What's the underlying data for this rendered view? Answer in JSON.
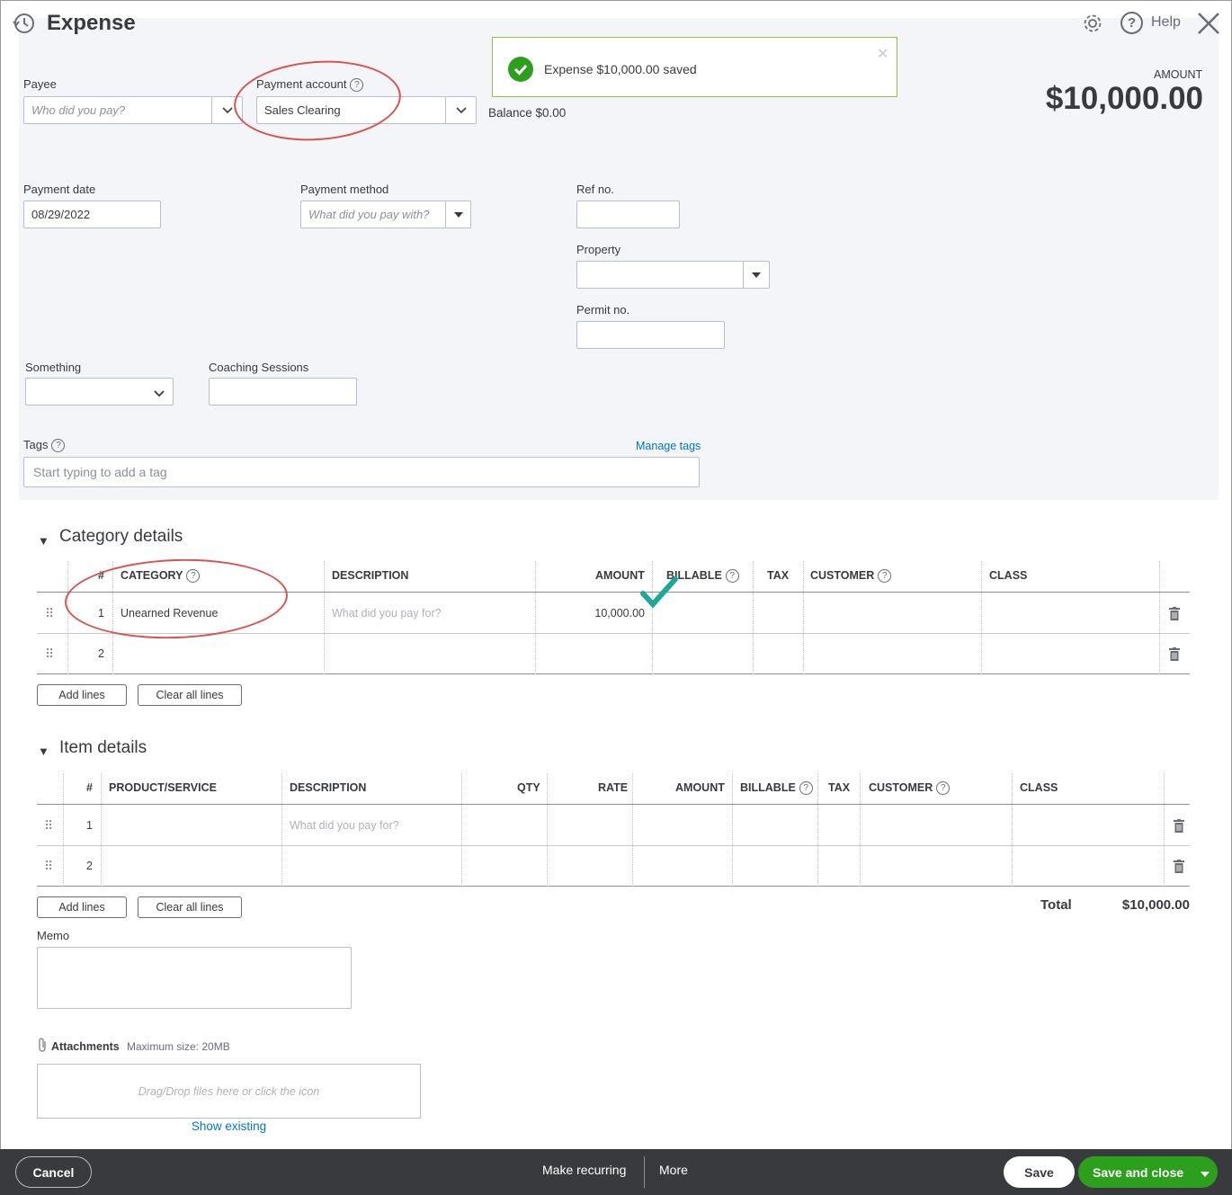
{
  "header": {
    "title": "Expense",
    "help_label": "Help"
  },
  "toast": {
    "message": "Expense $10,000.00 saved"
  },
  "amount": {
    "label": "AMOUNT",
    "value": "$10,000.00"
  },
  "payee": {
    "label": "Payee",
    "placeholder": "Who did you pay?"
  },
  "payment_account": {
    "label": "Payment account",
    "value": "Sales Clearing",
    "balance": "Balance $0.00"
  },
  "payment_date": {
    "label": "Payment date",
    "value": "08/29/2022"
  },
  "payment_method": {
    "label": "Payment method",
    "placeholder": "What did you pay with?"
  },
  "ref_no": {
    "label": "Ref no."
  },
  "property": {
    "label": "Property"
  },
  "permit_no": {
    "label": "Permit no."
  },
  "something": {
    "label": "Something"
  },
  "coaching": {
    "label": "Coaching Sessions"
  },
  "tags": {
    "label": "Tags",
    "manage": "Manage tags",
    "placeholder": "Start typing to add a tag"
  },
  "category_details": {
    "title": "Category details",
    "headers": {
      "num": "#",
      "category": "CATEGORY",
      "description": "DESCRIPTION",
      "amount": "AMOUNT",
      "billable": "BILLABLE",
      "tax": "TAX",
      "customer": "CUSTOMER",
      "class": "CLASS"
    },
    "rows": [
      {
        "num": "1",
        "category": "Unearned Revenue",
        "description_placeholder": "What did you pay for?",
        "amount": "10,000.00"
      },
      {
        "num": "2",
        "category": "",
        "description_placeholder": "",
        "amount": ""
      }
    ],
    "add_lines": "Add lines",
    "clear_lines": "Clear all lines"
  },
  "item_details": {
    "title": "Item details",
    "headers": {
      "num": "#",
      "product": "PRODUCT/SERVICE",
      "description": "DESCRIPTION",
      "qty": "QTY",
      "rate": "RATE",
      "amount": "AMOUNT",
      "billable": "BILLABLE",
      "tax": "TAX",
      "customer": "CUSTOMER",
      "class": "CLASS"
    },
    "rows": [
      {
        "num": "1",
        "description_placeholder": "What did you pay for?"
      },
      {
        "num": "2",
        "description_placeholder": ""
      }
    ],
    "add_lines": "Add lines",
    "clear_lines": "Clear all lines"
  },
  "total": {
    "label": "Total",
    "value": "$10,000.00"
  },
  "memo": {
    "label": "Memo"
  },
  "attachments": {
    "label": "Attachments",
    "max": "Maximum size: 20MB",
    "drop": "Drag/Drop files here or click the icon",
    "show_existing": "Show existing"
  },
  "footer": {
    "cancel": "Cancel",
    "recurring": "Make recurring",
    "more": "More",
    "save": "Save",
    "save_close": "Save and close"
  },
  "colors": {
    "accent_green": "#2ca01c",
    "toast_check": "#2ca01c",
    "link_blue": "#0077c5",
    "annotation_red": "#d9534f",
    "annotation_check": "#1fa896"
  }
}
